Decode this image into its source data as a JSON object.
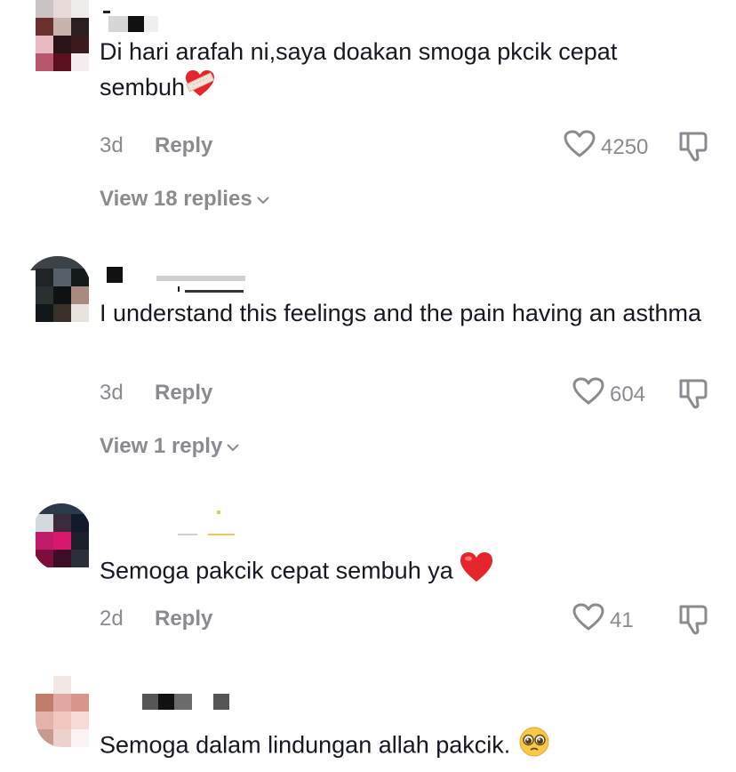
{
  "comments": [
    {
      "text": "Di hari arafah ni,saya doakan smoga pkcik cepat sembuh",
      "emoji": "heart-with-bandage",
      "time": "3d",
      "reply_label": "Reply",
      "likes": "4250",
      "view_replies": "View 18 replies"
    },
    {
      "text": "I understand this feelings and the pain having an asthma",
      "time": "3d",
      "reply_label": "Reply",
      "likes": "604",
      "view_replies": "View 1 reply"
    },
    {
      "text": "Semoga pakcik cepat sembuh ya",
      "emoji": "red-heart",
      "time": "2d",
      "reply_label": "Reply",
      "likes": "41"
    },
    {
      "text": "Semoga dalam lindungan allah pakcik.",
      "emoji": "pleading-face"
    }
  ],
  "colors": {
    "text": "#161823",
    "secondary": "#8a8b91",
    "heart_red": "#e5252b"
  },
  "icons": {
    "like": "heart-outline-icon",
    "dislike": "thumbs-down-icon",
    "expand": "chevron-down-icon"
  }
}
